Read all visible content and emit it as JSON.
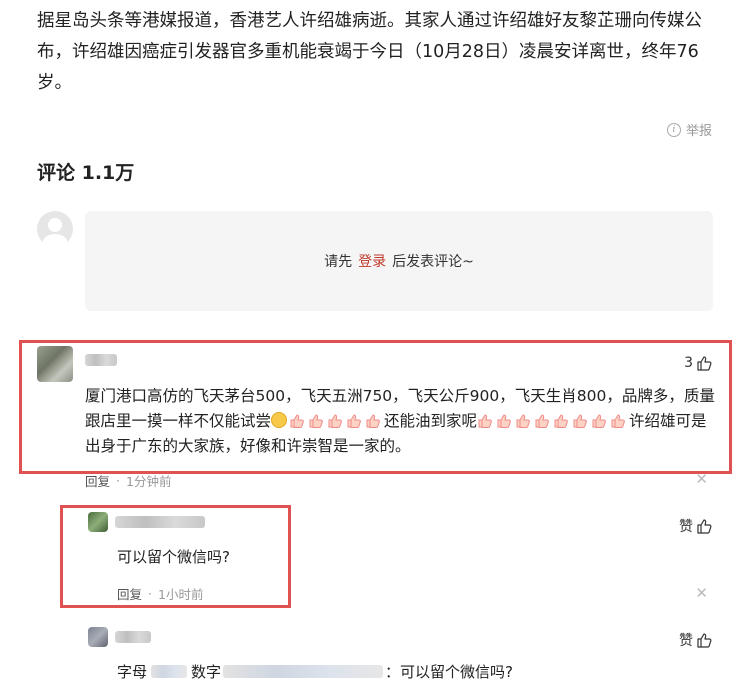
{
  "article": {
    "text": "据星岛头条等港媒报道，香港艺人许绍雄病逝。其家人通过许绍雄好友黎芷珊向传媒公布，许绍雄因癌症引发器官多重机能衰竭于今日（10月28日）凌晨安详离世，终年76岁。"
  },
  "report_label": "举报",
  "comments": {
    "header": "评论 1.1万",
    "box_prefix": "请先",
    "login_label": "登录",
    "box_suffix": "后发表评论~"
  },
  "comment1": {
    "likes": "3",
    "text_part1": "厦门港口高仿的飞天茅台500，飞天五洲750，飞天公斤900，飞天生肖800，品牌多，质量跟店里一摸一样不仅能试尝",
    "text_part2": "还能油到家呢",
    "text_part3": "许绍雄可是出身于广东的大家族，好像和许崇智是一家的。",
    "reply_label": "回复",
    "time": "1分钟前"
  },
  "reply1": {
    "like_label": "赞",
    "text": "可以留个微信吗?",
    "reply_label": "回复",
    "time": "1小时前"
  },
  "reply2": {
    "like_label": "赞",
    "text_prefix": "字母",
    "text_mid": "数字",
    "text_suffix": "：可以留个微信吗?"
  },
  "colors": {
    "accent_login": "#c0392b",
    "highlight_outline": "#e05252"
  },
  "icons": [
    "info-icon",
    "thumbs-up-icon",
    "close-icon",
    "default-avatar-icon",
    "hand-emoji-icon",
    "smile-emoji-icon"
  ]
}
